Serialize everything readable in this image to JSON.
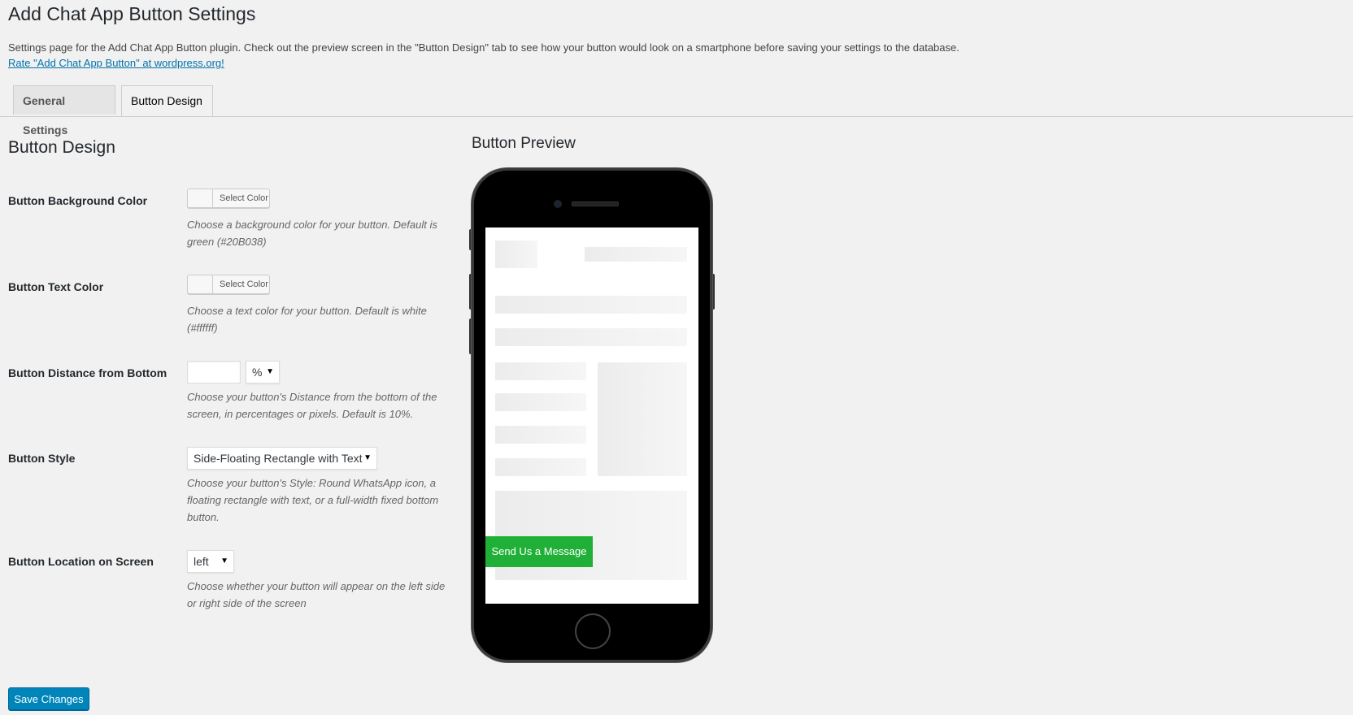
{
  "page": {
    "title": "Add Chat App Button Settings",
    "intro": "Settings page for the Add Chat App Button plugin. Check out the preview screen in the \"Button Design\" tab to see how your button would look on a smartphone before saving your settings to the database.",
    "rate_link": "Rate \"Add Chat App Button\" at wordpress.org!"
  },
  "tabs": [
    {
      "label": "General Settings",
      "active": false
    },
    {
      "label": "Button Design",
      "active": true
    }
  ],
  "section": {
    "title": "Button Design",
    "preview_title": "Button Preview"
  },
  "fields": {
    "bg_color": {
      "label": "Button Background Color",
      "button_text": "Select Color",
      "description": "Choose a background color for your button. Default is green (#20B038)"
    },
    "text_color": {
      "label": "Button Text Color",
      "button_text": "Select Color",
      "description": "Choose a text color for your button. Default is white (#ffffff)"
    },
    "distance": {
      "label": "Button Distance from Bottom",
      "value": "",
      "unit": "%",
      "description": "Choose your button's Distance from the bottom of the screen, in percentages or pixels. Default is 10%."
    },
    "style": {
      "label": "Button Style",
      "value": "Side-Floating Rectangle with Text",
      "description": "Choose your button's Style: Round WhatsApp icon, a floating rectangle with text, or a full-width fixed bottom button."
    },
    "location": {
      "label": "Button Location on Screen",
      "value": "left",
      "description": "Choose whether your button will appear on the left side or right side of the screen"
    }
  },
  "preview": {
    "chat_button_text": "Send Us a Message",
    "chat_button_color": "#20B038",
    "chat_button_text_color": "#ffffff"
  },
  "actions": {
    "save_label": "Save Changes"
  },
  "icons": {
    "select_arrow": "▼"
  }
}
